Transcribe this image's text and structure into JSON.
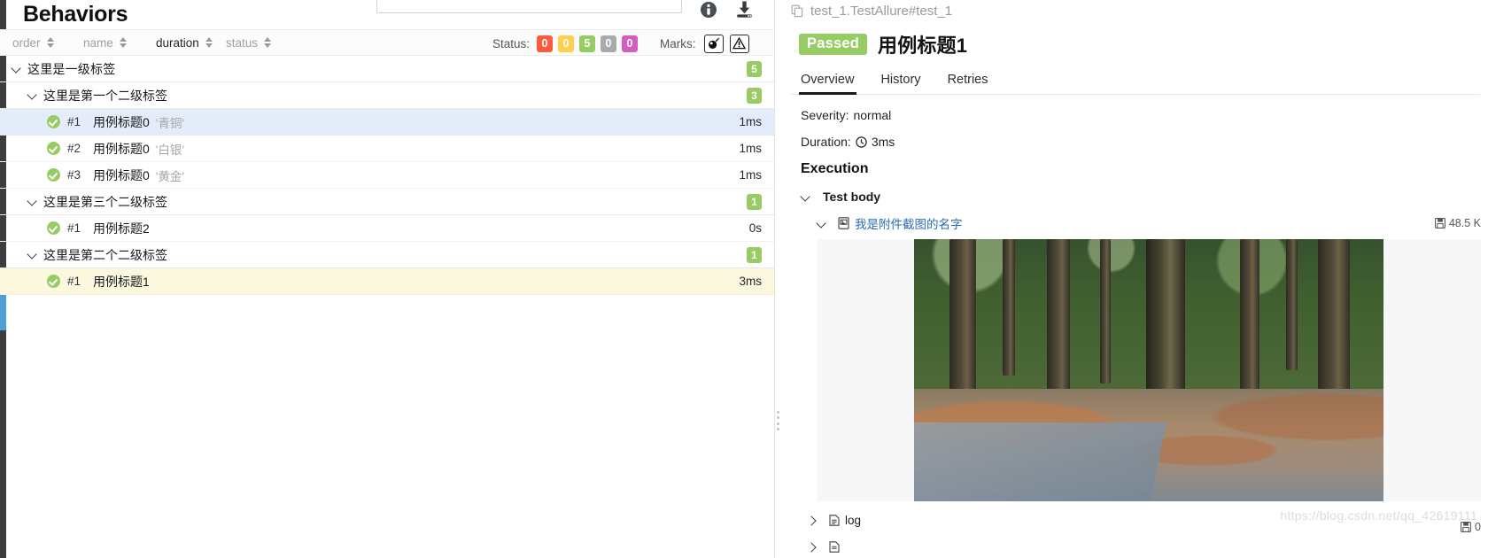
{
  "left": {
    "page_title": "Behaviors",
    "search": {
      "value": "",
      "placeholder": ""
    },
    "icons": {
      "info": "info-icon",
      "download": "download-icon"
    },
    "columns": [
      {
        "key": "order",
        "label": "order"
      },
      {
        "key": "name",
        "label": "name"
      },
      {
        "key": "duration",
        "label": "duration"
      },
      {
        "key": "status",
        "label": "status"
      }
    ],
    "status_filter": {
      "label": "Status:",
      "chips": [
        {
          "value": "0",
          "color": "#fd5a3e",
          "name": "failed"
        },
        {
          "value": "0",
          "color": "#ffd050",
          "name": "broken"
        },
        {
          "value": "5",
          "color": "#97cc64",
          "name": "passed"
        },
        {
          "value": "0",
          "color": "#aaaaaa",
          "name": "skipped"
        },
        {
          "value": "0",
          "color": "#d35ebe",
          "name": "unknown"
        }
      ]
    },
    "marks_filter": {
      "label": "Marks:",
      "buttons": [
        {
          "name": "flaky-bomb-icon"
        },
        {
          "name": "warning-triangle-icon"
        }
      ]
    },
    "tree": [
      {
        "type": "group",
        "level": 1,
        "label": "这里是一级标签",
        "count": "5",
        "expanded": true,
        "state": "none"
      },
      {
        "type": "group",
        "level": 2,
        "label": "这里是第一个二级标签",
        "count": "3",
        "expanded": true,
        "state": "none"
      },
      {
        "type": "case",
        "level": 3,
        "index": "#1",
        "name": "用例标题0",
        "tag": "'青铜'",
        "duration": "1ms",
        "status": "passed",
        "state": "hover"
      },
      {
        "type": "case",
        "level": 3,
        "index": "#2",
        "name": "用例标题0",
        "tag": "'白银'",
        "duration": "1ms",
        "status": "passed",
        "state": "none"
      },
      {
        "type": "case",
        "level": 3,
        "index": "#3",
        "name": "用例标题0",
        "tag": "'黄金'",
        "duration": "1ms",
        "status": "passed",
        "state": "none"
      },
      {
        "type": "group",
        "level": 2,
        "label": "这里是第三个二级标签",
        "count": "1",
        "expanded": true,
        "state": "none"
      },
      {
        "type": "case",
        "level": 3,
        "index": "#1",
        "name": "用例标题2",
        "tag": "",
        "duration": "0s",
        "status": "passed",
        "state": "none"
      },
      {
        "type": "group",
        "level": 2,
        "label": "这里是第二个二级标签",
        "count": "1",
        "expanded": true,
        "state": "none"
      },
      {
        "type": "case",
        "level": 3,
        "index": "#1",
        "name": "用例标题1",
        "tag": "",
        "duration": "3ms",
        "status": "passed",
        "state": "selected"
      }
    ]
  },
  "right": {
    "full_name": "test_1.TestAllure#test_1",
    "copy_icon": "copy-icon",
    "status_badge": "Passed",
    "test_title": "用例标题1",
    "tabs": [
      {
        "label": "Overview",
        "active": true
      },
      {
        "label": "History",
        "active": false
      },
      {
        "label": "Retries",
        "active": false
      }
    ],
    "severity_label": "Severity:",
    "severity_value": "normal",
    "duration_label": "Duration:",
    "duration_value": "3ms",
    "execution_heading": "Execution",
    "test_body_label": "Test body",
    "attachment": {
      "label": "我是附件截图的名字",
      "size": "48.5 K",
      "expanded": true
    },
    "log_item": {
      "label": "log",
      "expanded": false
    },
    "bottom_size": "0",
    "watermark": "https://blog.csdn.net/qq_42619111"
  }
}
